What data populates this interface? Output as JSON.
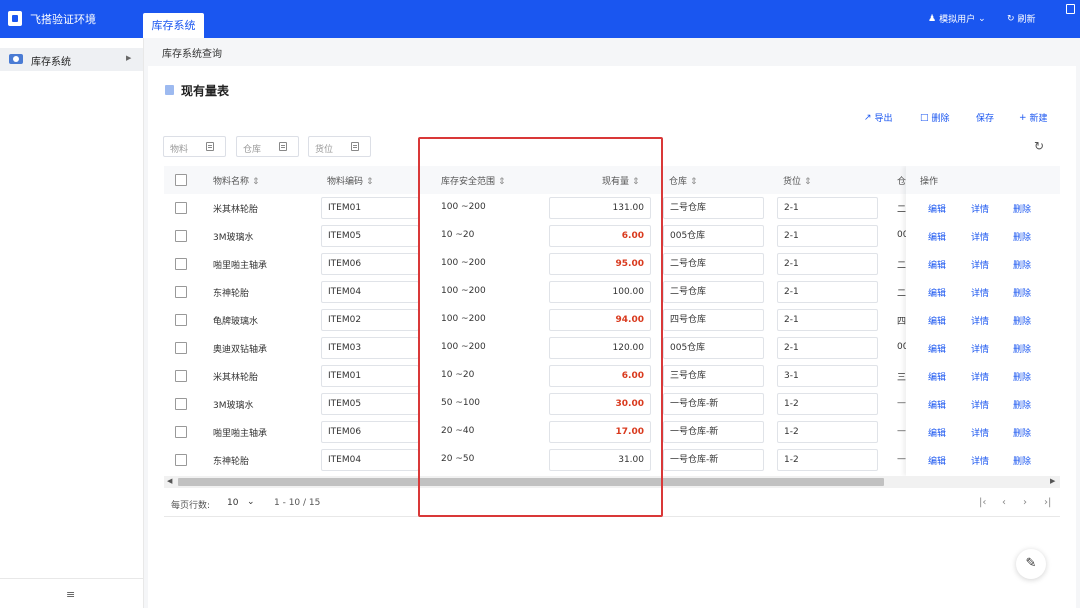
{
  "app": {
    "title": "飞搭验证环境",
    "top_tab": "库存系统",
    "user_label": "模拟用户",
    "refresh_label": "刷新"
  },
  "sidebar": {
    "items": [
      {
        "label": "库存系统"
      }
    ]
  },
  "breadcrumb": "库存系统查询",
  "section": {
    "title": "现有量表"
  },
  "toolbar": {
    "export": "导出",
    "delete": "删除",
    "save": "保存",
    "new": "新建"
  },
  "filters": {
    "material": "物料",
    "warehouse": "仓库",
    "location": "货位"
  },
  "table": {
    "columns": [
      "物料名称",
      "物料编码",
      "库存安全范围",
      "现有量",
      "仓库",
      "货位",
      "仓",
      "操作"
    ],
    "rows": [
      {
        "name": "米其林轮胎",
        "code": "ITEM01",
        "range": "100 ~200",
        "qty": "131.00",
        "low": false,
        "warehouse": "二号仓库",
        "location": "2-1",
        "extra": "二"
      },
      {
        "name": "3M玻璃水",
        "code": "ITEM05",
        "range": "10 ~20",
        "qty": "6.00",
        "low": true,
        "warehouse": "005仓库",
        "location": "2-1",
        "extra": "00"
      },
      {
        "name": "啪里啪主轴承",
        "code": "ITEM06",
        "range": "100 ~200",
        "qty": "95.00",
        "low": true,
        "warehouse": "二号仓库",
        "location": "2-1",
        "extra": "二"
      },
      {
        "name": "东神轮胎",
        "code": "ITEM04",
        "range": "100 ~200",
        "qty": "100.00",
        "low": false,
        "warehouse": "二号仓库",
        "location": "2-1",
        "extra": "二"
      },
      {
        "name": "龟牌玻璃水",
        "code": "ITEM02",
        "range": "100 ~200",
        "qty": "94.00",
        "low": true,
        "warehouse": "四号仓库",
        "location": "2-1",
        "extra": "四"
      },
      {
        "name": "奥迪双钻轴承",
        "code": "ITEM03",
        "range": "100 ~200",
        "qty": "120.00",
        "low": false,
        "warehouse": "005仓库",
        "location": "2-1",
        "extra": "00"
      },
      {
        "name": "米其林轮胎",
        "code": "ITEM01",
        "range": "10 ~20",
        "qty": "6.00",
        "low": true,
        "warehouse": "三号仓库",
        "location": "3-1",
        "extra": "三"
      },
      {
        "name": "3M玻璃水",
        "code": "ITEM05",
        "range": "50 ~100",
        "qty": "30.00",
        "low": true,
        "warehouse": "一号仓库-新",
        "location": "1-2",
        "extra": "—"
      },
      {
        "name": "啪里啪主轴承",
        "code": "ITEM06",
        "range": "20 ~40",
        "qty": "17.00",
        "low": true,
        "warehouse": "一号仓库-新",
        "location": "1-2",
        "extra": "—"
      },
      {
        "name": "东神轮胎",
        "code": "ITEM04",
        "range": "20 ~50",
        "qty": "31.00",
        "low": false,
        "warehouse": "一号仓库-新",
        "location": "1-2",
        "extra": "—"
      }
    ],
    "actions": {
      "edit": "编辑",
      "detail": "详情",
      "delete": "删除"
    }
  },
  "pagination": {
    "rows_per_page_label": "每页行数:",
    "page_size": "10",
    "range": "1 - 10 / 15"
  },
  "colors": {
    "brand": "#1a56f0",
    "low_stock": "#d93a1e",
    "highlight_box": "#d93838"
  }
}
